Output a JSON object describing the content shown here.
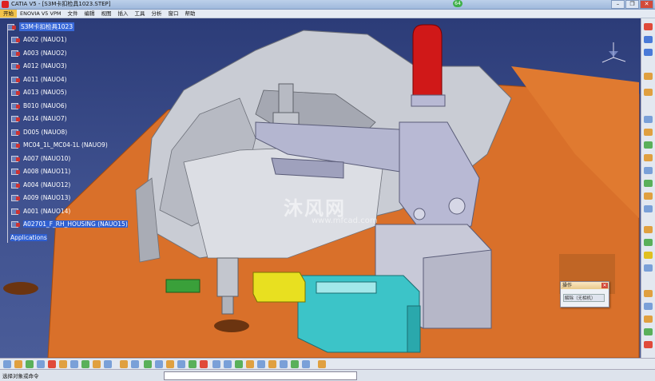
{
  "window": {
    "title": "CATIA V5 - [S3M卡扣检具1023.STEP]",
    "badge": "64"
  },
  "window_buttons": {
    "minimize": "–",
    "restore": "❐",
    "close": "✕"
  },
  "menu": [
    {
      "label": "开始",
      "active": true
    },
    {
      "label": "ENOVIA V5 VPM"
    },
    {
      "label": "文件"
    },
    {
      "label": "编辑"
    },
    {
      "label": "视图"
    },
    {
      "label": "插入"
    },
    {
      "label": "工具"
    },
    {
      "label": "分析"
    },
    {
      "label": "窗口"
    },
    {
      "label": "帮助"
    }
  ],
  "tree": {
    "root": "S3M卡扣检具1023",
    "items": [
      "A002 (NAUO1)",
      "A003 (NAUO2)",
      "A012 (NAUO3)",
      "A011 (NAUO4)",
      "A013 (NAUO5)",
      "B010 (NAUO6)",
      "A014 (NAUO7)",
      "D005 (NAUO8)",
      "MC04_1L_MC04-1L (NAUO9)",
      "A007 (NAUO10)",
      "A008 (NAUO11)",
      "A004 (NAUO12)",
      "A009 (NAUO13)",
      "A001 (NAUO14)",
      "A02701_F_RH_HOUSING (NAUO15)"
    ],
    "footer": "Applications"
  },
  "watermark": {
    "text": "沐风网",
    "url": "www.mfcad.com"
  },
  "mini_dialog": {
    "title": "操作",
    "button": "解除（无相机）"
  },
  "status": {
    "message": "选择对象或命令"
  },
  "colors": {
    "viewport_top": "#2c3c78",
    "fixture_base": "#e0742a",
    "clamp_red": "#d01818",
    "block_cyan": "#3cc4c8",
    "block_yellow": "#e8e020",
    "block_green": "#3aa03a"
  }
}
